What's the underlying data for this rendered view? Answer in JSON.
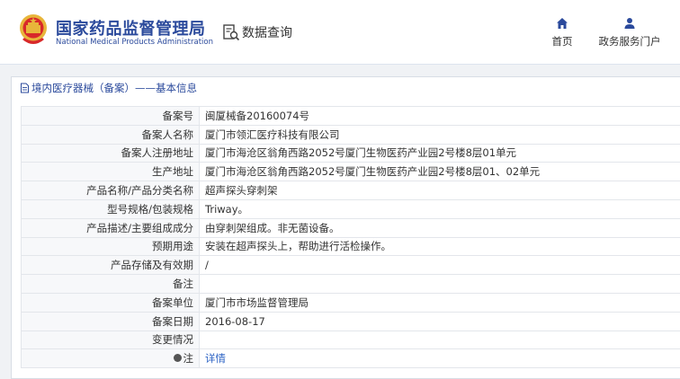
{
  "header": {
    "brand_cn": "国家药品监督管理局",
    "brand_en": "National Medical Products Administration",
    "query_label": "数据查询",
    "nav": [
      {
        "label": "首页",
        "icon": "home-icon"
      },
      {
        "label": "政务服务门户",
        "icon": "user-icon"
      }
    ]
  },
  "panel": {
    "title": "境内医疗器械（备案）——基本信息",
    "rows": [
      {
        "key": "备案号",
        "value": "闽厦械备20160074号"
      },
      {
        "key": "备案人名称",
        "value": "厦门市领汇医疗科技有限公司"
      },
      {
        "key": "备案人注册地址",
        "value": "厦门市海沧区翁角西路2052号厦门生物医药产业园2号楼8层01单元"
      },
      {
        "key": "生产地址",
        "value": "厦门市海沧区翁角西路2052号厦门生物医药产业园2号楼8层01、02单元"
      },
      {
        "key": "产品名称/产品分类名称",
        "value": "超声探头穿刺架"
      },
      {
        "key": "型号规格/包装规格",
        "value": "Triway。"
      },
      {
        "key": "产品描述/主要组成成分",
        "value": "由穿刺架组成。非无菌设备。"
      },
      {
        "key": "预期用途",
        "value": "安装在超声探头上，帮助进行活检操作。"
      },
      {
        "key": "产品存储及有效期",
        "value": "/"
      },
      {
        "key": "备注",
        "value": ""
      },
      {
        "key": "备案单位",
        "value": "厦门市市场监督管理局"
      },
      {
        "key": "备案日期",
        "value": "2016-08-17"
      },
      {
        "key": "变更情况",
        "value": ""
      }
    ],
    "note": {
      "key": "注",
      "link": "详情"
    }
  },
  "colors": {
    "brand": "#2b4a9c",
    "link": "#2b62c4",
    "band": "#f0f2f5"
  }
}
